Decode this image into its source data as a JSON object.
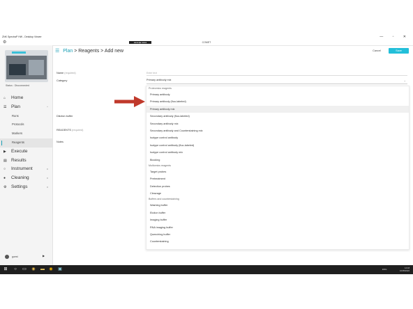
{
  "window": {
    "title": "ZNK SpectraP HW - Desktop Viewer",
    "controls": "— ▫ ✕",
    "app_name": "COMET",
    "center_badge": "●●●●  ▶ ●●●●"
  },
  "sidebar": {
    "status": "Status : Disconnected",
    "items": [
      {
        "label": "Home",
        "icon": "home-icon"
      },
      {
        "label": "Plan",
        "icon": "list-icon",
        "expanded": true
      },
      {
        "label": "Execute",
        "icon": "play-icon"
      },
      {
        "label": "Results",
        "icon": "chart-icon"
      },
      {
        "label": "Instrument",
        "icon": "circle-icon"
      },
      {
        "label": "Cleaning",
        "icon": "drop-icon"
      },
      {
        "label": "Settings",
        "icon": "gear-icon"
      }
    ],
    "plan_sub": [
      {
        "label": "Runs"
      },
      {
        "label": "Protocols"
      },
      {
        "label": "Markers"
      },
      {
        "label": "Reagents",
        "active": true
      }
    ],
    "user": "guest"
  },
  "breadcrumb": {
    "plan": "Plan",
    "sep": ">",
    "reagents": "Reagents",
    "add_new": "Add new"
  },
  "actions": {
    "cancel": "Cancel",
    "save": "Save"
  },
  "form": {
    "name_label": "Name",
    "name_req": "(required)",
    "name_placeholder": "Enter text",
    "category_label": "Category",
    "category_value": "Primary antibody mix",
    "dilution_label": "Dilution buffer",
    "reagents_label": "REAGENTS",
    "reagents_req": "(required)",
    "notes_label": "Notes"
  },
  "dropdown": {
    "groups": [
      {
        "label": "Proteomics reagents",
        "options": [
          "Primary antibody",
          "Primary antibody (fluo-labeled)",
          "Primary antibody mix",
          "Secondary antibody (fluo-labeled)",
          "Secondary antibody mix",
          "Secondary antibody and Counterstaining mix",
          "Isotype control antibody",
          "Isotype control antibody (fluo-labeled)",
          "Isotype control antibody mix",
          "Blocking"
        ]
      },
      {
        "label": "Multiomics reagents",
        "options": [
          "Target probes",
          "Pretreatment",
          "Detection probes",
          "Cleavage"
        ]
      },
      {
        "label": "Buffers and counterstaining",
        "options": [
          "Washing buffer",
          "Elution buffer",
          "Imaging buffer",
          "RNA imaging buffer",
          "Quenching buffer",
          "Counterstaining"
        ]
      }
    ],
    "selected": "Primary antibody mix"
  },
  "taskbar": {
    "time": "14:18",
    "date": "10/05/2022",
    "lang": "ENG"
  },
  "colors": {
    "accent": "#1a9fb5",
    "save": "#23bfd9",
    "arrow": "#c0392b",
    "taskbar": "#1f1f1f"
  }
}
